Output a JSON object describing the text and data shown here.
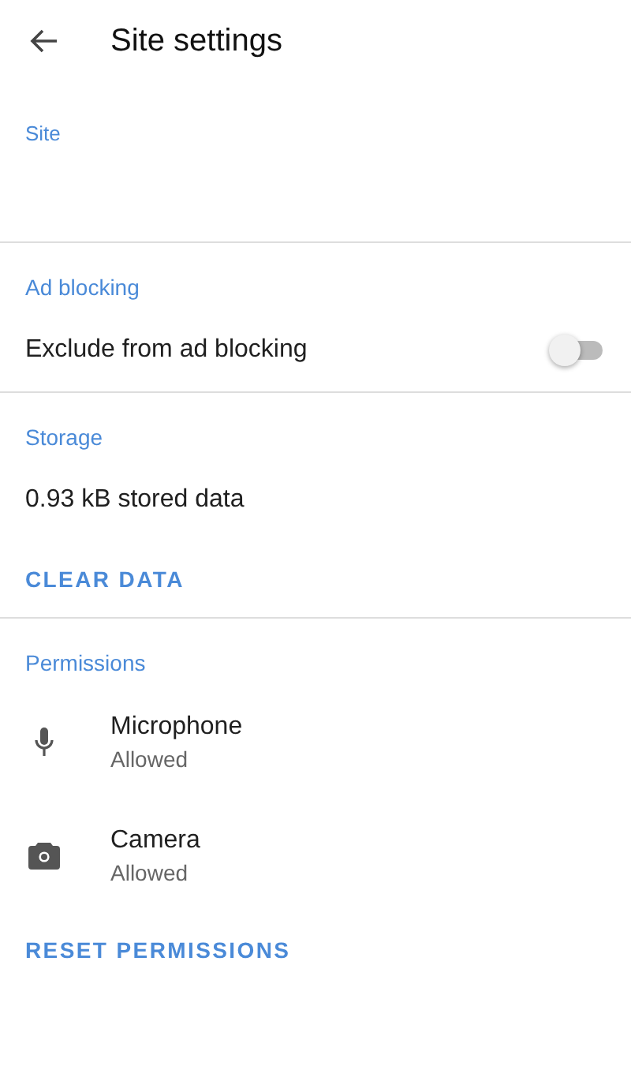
{
  "app_bar": {
    "title": "Site settings"
  },
  "site": {
    "heading": "Site"
  },
  "ad_blocking": {
    "heading": "Ad blocking",
    "toggle": {
      "label": "Exclude from ad blocking",
      "on": false
    }
  },
  "storage": {
    "heading": "Storage",
    "usage": "0.93 kB stored data",
    "action": "CLEAR DATA"
  },
  "permissions": {
    "heading": "Permissions",
    "items": [
      {
        "kind": "microphone",
        "name": "Microphone",
        "status": "Allowed"
      },
      {
        "kind": "camera",
        "name": "Camera",
        "status": "Allowed"
      }
    ],
    "action": "RESET PERMISSIONS"
  }
}
